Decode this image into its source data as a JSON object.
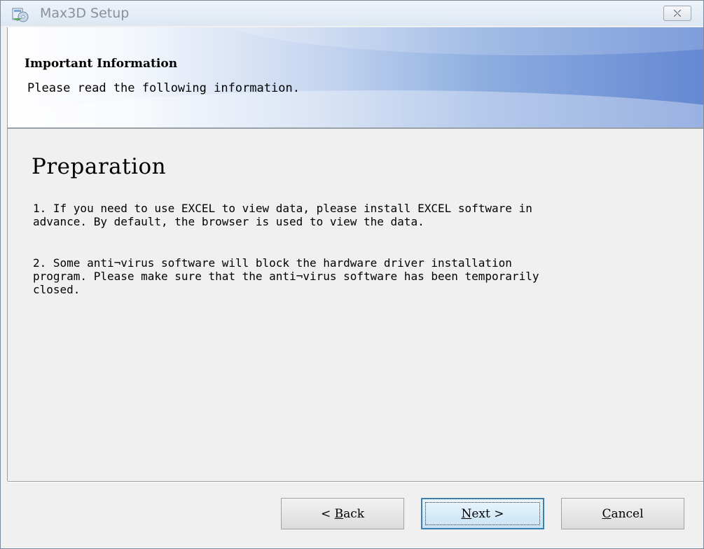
{
  "window": {
    "title": "Max3D Setup",
    "icons": {
      "app": "setup-cd-icon",
      "close": "close-icon"
    },
    "close_glyph": "⛌"
  },
  "banner": {
    "title": "Important Information",
    "subtitle": "Please read the following information."
  },
  "content": {
    "heading": "Preparation",
    "paragraphs": [
      "1. If you need to use EXCEL to view data, please install EXCEL software in\nadvance. By default, the browser is used to view the data.",
      "2. Some anti¬virus software will block the hardware driver installation\nprogram. Please make sure that the anti¬virus software has been temporarily\nclosed."
    ]
  },
  "buttons": {
    "back": {
      "prefix": "< ",
      "mnemonic": "B",
      "rest": "ack"
    },
    "next": {
      "mnemonic": "N",
      "rest": "ext >"
    },
    "cancel": {
      "mnemonic": "C",
      "rest": "ancel"
    }
  },
  "colors": {
    "accent_blue": "#6488d3",
    "focus_border": "#3c7fb1"
  }
}
